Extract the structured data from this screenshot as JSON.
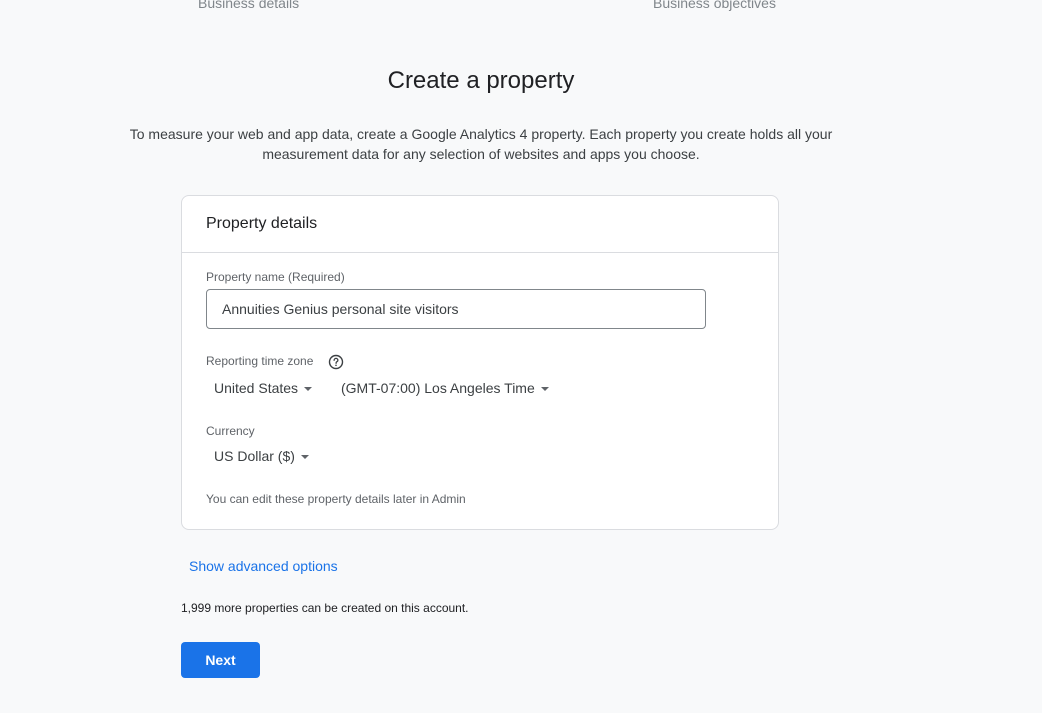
{
  "stepper": {
    "step_1": "Business details",
    "step_2": "Business objectives"
  },
  "page": {
    "title": "Create a property",
    "description": "To measure your web and app data, create a Google Analytics 4 property. Each property you create holds all your measurement data for any selection of websites and apps you choose."
  },
  "card": {
    "header": "Property details",
    "property_name_label": "Property name (Required)",
    "property_name_value": "Annuities Genius personal site visitors",
    "timezone_label": "Reporting time zone",
    "country_value": "United States",
    "timezone_value": "(GMT-07:00) Los Angeles Time",
    "currency_label": "Currency",
    "currency_value": "US Dollar ($)",
    "hint": "You can edit these property details later in Admin"
  },
  "advanced_link": "Show advanced options",
  "quota_text": "1,999 more properties can be created on this account.",
  "next_button": "Next",
  "icons": {
    "help": "help-circle-icon",
    "dropdown": "caret-down-icon"
  },
  "colors": {
    "accent": "#1a73e8",
    "background": "#f8f9fa",
    "card_border": "#dadce0"
  }
}
